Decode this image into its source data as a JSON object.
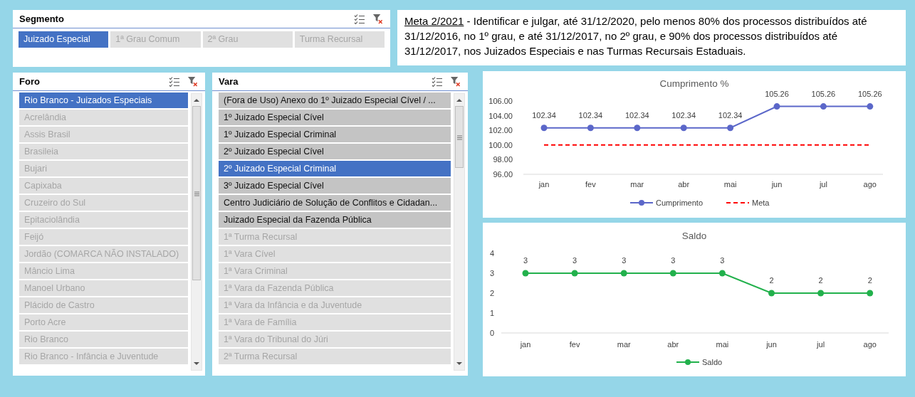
{
  "segmento": {
    "title": "Segmento",
    "items": [
      {
        "label": "Juizado Especial",
        "selected": true,
        "available": true
      },
      {
        "label": "1ª Grau Comum",
        "selected": false,
        "available": false
      },
      {
        "label": "2ª Grau",
        "selected": false,
        "available": false
      },
      {
        "label": "Turma Recursal",
        "selected": false,
        "available": false
      }
    ]
  },
  "goal": {
    "label": "Meta 2/2021",
    "text": "- Identificar e julgar, até 31/12/2020, pelo menos 80% dos processos distribuídos até 31/12/2016, no 1º grau, e até 31/12/2017, no 2º grau, e 90% dos processos distribuídos até 31/12/2017, nos Juizados Especiais e nas Turmas Recursais Estaduais."
  },
  "foro": {
    "title": "Foro",
    "items": [
      {
        "label": "Rio Branco - Juizados Especiais",
        "selected": true,
        "available": true
      },
      {
        "label": "Acrelândia",
        "selected": false,
        "available": false
      },
      {
        "label": "Assis Brasil",
        "selected": false,
        "available": false
      },
      {
        "label": "Brasileia",
        "selected": false,
        "available": false
      },
      {
        "label": "Bujari",
        "selected": false,
        "available": false
      },
      {
        "label": "Capixaba",
        "selected": false,
        "available": false
      },
      {
        "label": "Cruzeiro do Sul",
        "selected": false,
        "available": false
      },
      {
        "label": "Epitaciolândia",
        "selected": false,
        "available": false
      },
      {
        "label": "Feijó",
        "selected": false,
        "available": false
      },
      {
        "label": "Jordão (COMARCA NÃO INSTALADO)",
        "selected": false,
        "available": false
      },
      {
        "label": "Mâncio Lima",
        "selected": false,
        "available": false
      },
      {
        "label": "Manoel Urbano",
        "selected": false,
        "available": false
      },
      {
        "label": "Plácido de Castro",
        "selected": false,
        "available": false
      },
      {
        "label": "Porto Acre",
        "selected": false,
        "available": false
      },
      {
        "label": "Rio Branco",
        "selected": false,
        "available": false
      },
      {
        "label": "Rio Branco - Infância e Juventude",
        "selected": false,
        "available": false
      }
    ]
  },
  "vara": {
    "title": "Vara",
    "items": [
      {
        "label": "(Fora de Uso) Anexo do 1º Juizado Especial Cível / ...",
        "selected": false,
        "available": true
      },
      {
        "label": "1º Juizado Especial Cível",
        "selected": false,
        "available": true
      },
      {
        "label": "1º Juizado Especial Criminal",
        "selected": false,
        "available": true
      },
      {
        "label": "2º Juizado Especial Cível",
        "selected": false,
        "available": true
      },
      {
        "label": "2º Juizado Especial Criminal",
        "selected": true,
        "available": true
      },
      {
        "label": "3º Juizado Especial Cível",
        "selected": false,
        "available": true
      },
      {
        "label": "Centro Judiciário de Solução de Conflitos e Cidadan...",
        "selected": false,
        "available": true
      },
      {
        "label": "Juizado Especial da Fazenda Pública",
        "selected": false,
        "available": true
      },
      {
        "label": "1ª Turma Recursal",
        "selected": false,
        "available": false
      },
      {
        "label": "1ª Vara Cível",
        "selected": false,
        "available": false
      },
      {
        "label": "1ª Vara Criminal",
        "selected": false,
        "available": false
      },
      {
        "label": "1ª Vara da Fazenda Pública",
        "selected": false,
        "available": false
      },
      {
        "label": "1ª Vara da Infância e da Juventude",
        "selected": false,
        "available": false
      },
      {
        "label": "1ª Vara de Família",
        "selected": false,
        "available": false
      },
      {
        "label": "1ª Vara do Tribunal do Júri",
        "selected": false,
        "available": false
      },
      {
        "label": "2ª Turma Recursal",
        "selected": false,
        "available": false
      }
    ]
  },
  "charts": [
    {
      "chart_data": {
        "type": "line",
        "title": "Cumprimento %",
        "categories": [
          "jan",
          "fev",
          "mar",
          "abr",
          "mai",
          "jun",
          "jul",
          "ago"
        ],
        "ylim": [
          96,
          106
        ],
        "legend": "bottom",
        "yticks": [
          {
            "value": 96,
            "label": "96.00"
          },
          {
            "value": 98,
            "label": "98.00"
          },
          {
            "value": 100,
            "label": "100.00"
          },
          {
            "value": 102,
            "label": "102.00"
          },
          {
            "value": 104,
            "label": "104.00"
          },
          {
            "value": 106,
            "label": "106.00"
          }
        ],
        "series": [
          {
            "name": "Cumprimento",
            "color": "#5b67c9",
            "line_style": "solid",
            "marker": "circle",
            "values": [
              102.34,
              102.34,
              102.34,
              102.34,
              102.34,
              105.26,
              105.26,
              105.26
            ],
            "value_labels": [
              "102.34",
              "102.34",
              "102.34",
              "102.34",
              "102.34",
              "105.26",
              "105.26",
              "105.26"
            ]
          },
          {
            "name": "Meta",
            "color": "#ff0000",
            "line_style": "dashed",
            "values": [
              100,
              100,
              100,
              100,
              100,
              100,
              100,
              100
            ]
          }
        ]
      }
    },
    {
      "chart_data": {
        "type": "line",
        "title": "Saldo",
        "categories": [
          "jan",
          "fev",
          "mar",
          "abr",
          "mai",
          "jun",
          "jul",
          "ago"
        ],
        "ylim": [
          0,
          4
        ],
        "legend": "bottom",
        "yticks": [
          0,
          1,
          2,
          3,
          4
        ],
        "series": [
          {
            "name": "Saldo",
            "color": "#22b14c",
            "line_style": "solid",
            "marker": "circle",
            "values": [
              3,
              3,
              3,
              3,
              3,
              2,
              2,
              2
            ],
            "value_labels": [
              "3",
              "3",
              "3",
              "3",
              "3",
              "2",
              "2",
              "2"
            ]
          }
        ]
      }
    }
  ]
}
